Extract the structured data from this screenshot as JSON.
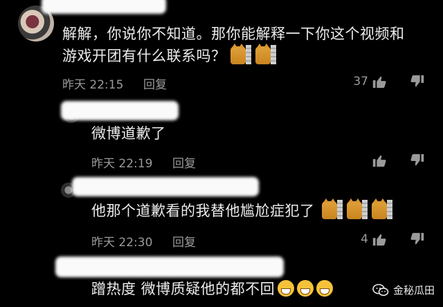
{
  "comments": [
    {
      "text_line1": "解解，你说你不知道。那你能解释一下你这个视频和",
      "text_line2": "游戏开团有什么联系吗？",
      "time": "昨天 22:15",
      "reply": "回复",
      "likes": "37"
    },
    {
      "text_line1": "微博道歉了",
      "time": "昨天 22:19",
      "reply": "回复",
      "likes": ""
    },
    {
      "text_line1": "他那个道歉看的我替他尴尬症犯了",
      "time": "昨天 22:30",
      "reply": "回复",
      "likes": "4"
    },
    {
      "text_line1": "蹭热度 微博质疑他的都不回"
    }
  ],
  "watermark": "金秘瓜田",
  "icons": {
    "like": "thumbs-up-icon",
    "dislike": "thumbs-down-icon",
    "emoji_cat": "cat-emoji",
    "emoji_face": "grinning-sweat-emoji",
    "brand": "wechat-icon"
  }
}
